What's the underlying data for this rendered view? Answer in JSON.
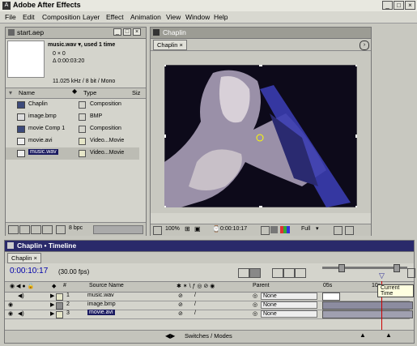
{
  "app": {
    "title": "Adobe After Effects"
  },
  "menu": [
    "File",
    "Edit",
    "Composition",
    "Layer",
    "Effect",
    "Animation",
    "View",
    "Window",
    "Help"
  ],
  "project": {
    "title": "start.aep",
    "preview_name": "music.wav ▾, used 1 time",
    "preview_line2": "0 × 0",
    "preview_line3": "Δ 0:00:03:20",
    "preview_line4": "11.025 kHz / 8 bit / Mono",
    "col_name": "Name",
    "col_type": "Type",
    "col_size": "Siz",
    "items": [
      {
        "name": "Chaplin",
        "type": "Composition",
        "swatch": "#8c8c8c"
      },
      {
        "name": "image.bmp",
        "type": "BMP",
        "swatch": "#8c8c8c"
      },
      {
        "name": "movie Comp 1",
        "type": "Composition",
        "swatch": "#8c8c8c"
      },
      {
        "name": "movie.avi",
        "type": "Video...Movie",
        "swatch": "#e6e6c8"
      },
      {
        "name": "music.wav",
        "type": "Video...Movie",
        "swatch": "#e6e6c8"
      }
    ],
    "bpc": "8 bpc"
  },
  "comp": {
    "title": "Chaplin",
    "tab": "Chaplin",
    "zoom": "100%",
    "timecode": "0:00:10:17",
    "quality": "Full"
  },
  "timeline": {
    "title": "Chaplin • Timeline",
    "tab": "Chaplin",
    "timecode": "0:00:10:17",
    "fps": "(30.00 fps)",
    "col_source": "Source Name",
    "col_parent": "Parent",
    "ruler_start": "05s",
    "ruler_mid": "10s",
    "tooltip": "Current Time",
    "switches": "Switches / Modes",
    "layers": [
      {
        "num": "1",
        "name": "music.wav",
        "parent": "None"
      },
      {
        "num": "2",
        "name": "image.bmp",
        "parent": "None"
      },
      {
        "num": "3",
        "name": "movie.avi",
        "parent": "None"
      }
    ]
  }
}
